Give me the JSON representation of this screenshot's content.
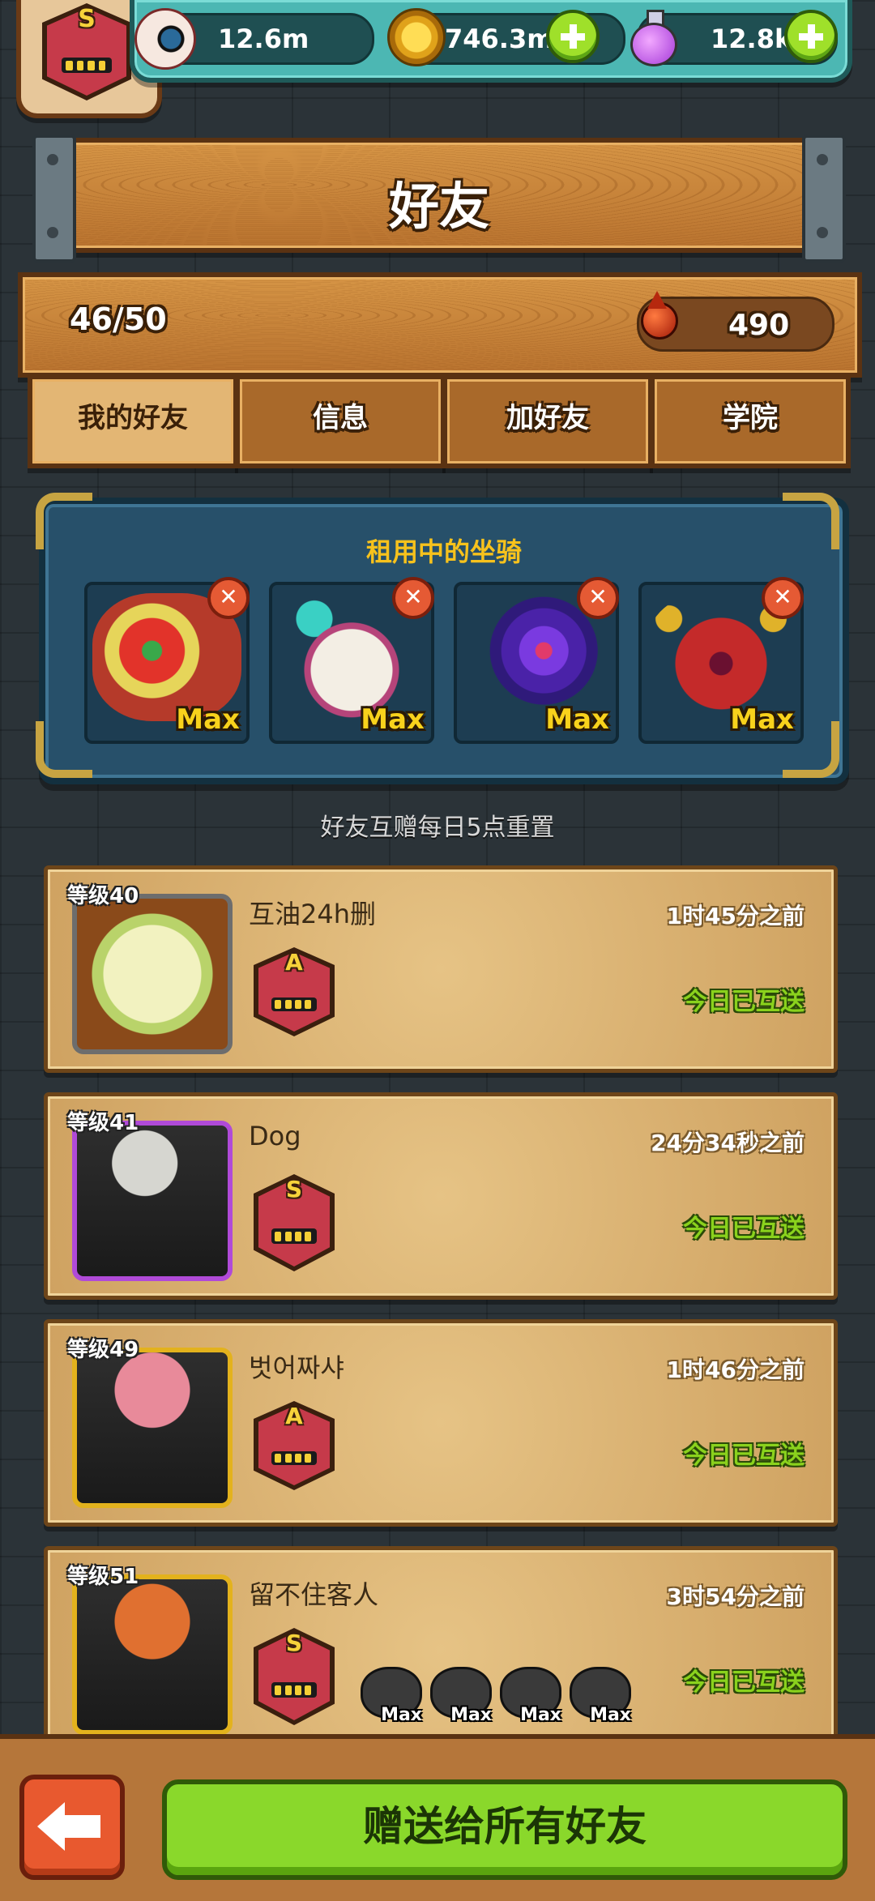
{
  "player": {
    "rank": "S"
  },
  "resources": {
    "eyes": "12.6m",
    "coins": "746.3m",
    "potions": "12.8k"
  },
  "header": {
    "title": "好友"
  },
  "stats": {
    "friend_count": "46/50",
    "blood_points": "490"
  },
  "tabs": [
    {
      "label": "我的好友",
      "active": true
    },
    {
      "label": "信息",
      "active": false
    },
    {
      "label": "加好友",
      "active": false
    },
    {
      "label": "学院",
      "active": false
    }
  ],
  "rental": {
    "title": "租用中的坐骑",
    "mounts": [
      {
        "level_label": "Max",
        "color": "#d8442a"
      },
      {
        "level_label": "Max",
        "color": "#e9e1d8"
      },
      {
        "level_label": "Max",
        "color": "#6a3ad0"
      },
      {
        "level_label": "Max",
        "color": "#c0282a"
      }
    ]
  },
  "reset_note": "好友互赠每日5点重置",
  "friends": [
    {
      "level": "等级40",
      "name": "互油24h删",
      "time": "1时45分之前",
      "status": "今日已互送",
      "rank": "A",
      "avatar_color": "#d8e5a0",
      "frame_color": "#6d6d6d",
      "mounts": []
    },
    {
      "level": "等级41",
      "name": "Dog",
      "time": "24分34秒之前",
      "status": "今日已互送",
      "rank": "S",
      "avatar_color": "#2e2e2e",
      "frame_color": "#b04ad8",
      "mounts": []
    },
    {
      "level": "等级49",
      "name": "벗어짜샤",
      "time": "1时46分之前",
      "status": "今日已互送",
      "rank": "A",
      "avatar_color": "#2e2e2e",
      "frame_color": "#e3b21d",
      "mounts": []
    },
    {
      "level": "等级51",
      "name": "留不住客人",
      "time": "3时54分之前",
      "status": "今日已互送",
      "rank": "S",
      "avatar_color": "#2e2e2e",
      "frame_color": "#e3b21d",
      "mounts": [
        {
          "label": "Max"
        },
        {
          "label": "Max"
        },
        {
          "label": "Max"
        },
        {
          "label": "Max"
        }
      ]
    }
  ],
  "footer": {
    "gift_all_label": "赠送给所有好友"
  }
}
